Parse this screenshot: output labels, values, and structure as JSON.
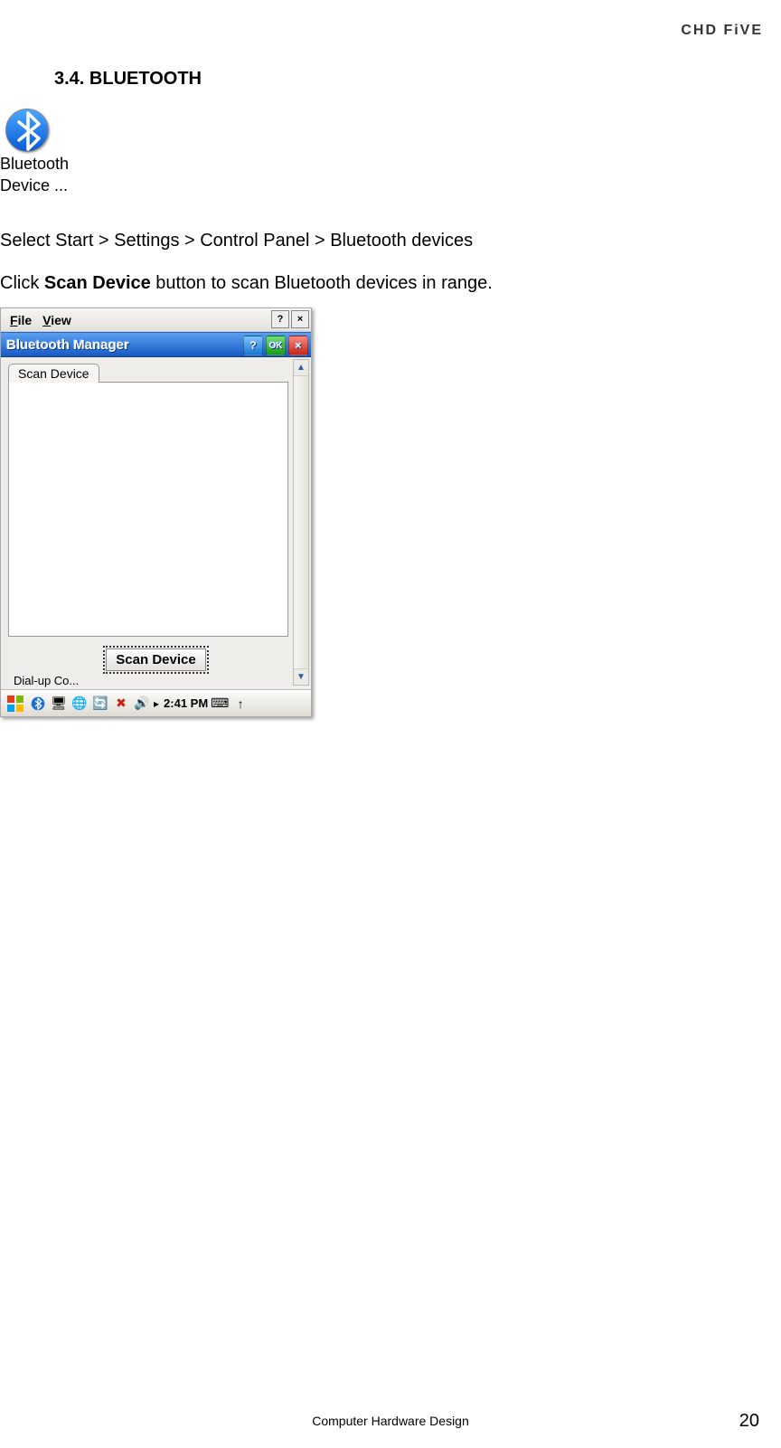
{
  "header": {
    "brand": "CHD FiVE"
  },
  "section": {
    "number": "3.4.",
    "title_prefix": "B",
    "title_rest": "LUETOOTH"
  },
  "desktop_icon": {
    "label_line1": "Bluetooth",
    "label_line2": "Device ..."
  },
  "body": {
    "line1": "Select Start > Settings > Control Panel > Bluetooth devices",
    "line2_pre": "Click ",
    "line2_bold": "Scan Device",
    "line2_post": " button to scan Bluetooth devices in range."
  },
  "wince": {
    "menubar": {
      "file": "File",
      "view": "View",
      "help_icon": "?",
      "close_icon": "×"
    },
    "titlebar": {
      "title": "Bluetooth Manager",
      "help": "?",
      "ok": "OK",
      "close": "×"
    },
    "tab": "Scan Device",
    "scan_button": "Scan Device",
    "bg_label": "Dial-up Co...",
    "taskbar": {
      "time": "2:41 PM"
    }
  },
  "footer": {
    "text": "Computer Hardware Design",
    "page": "20"
  }
}
